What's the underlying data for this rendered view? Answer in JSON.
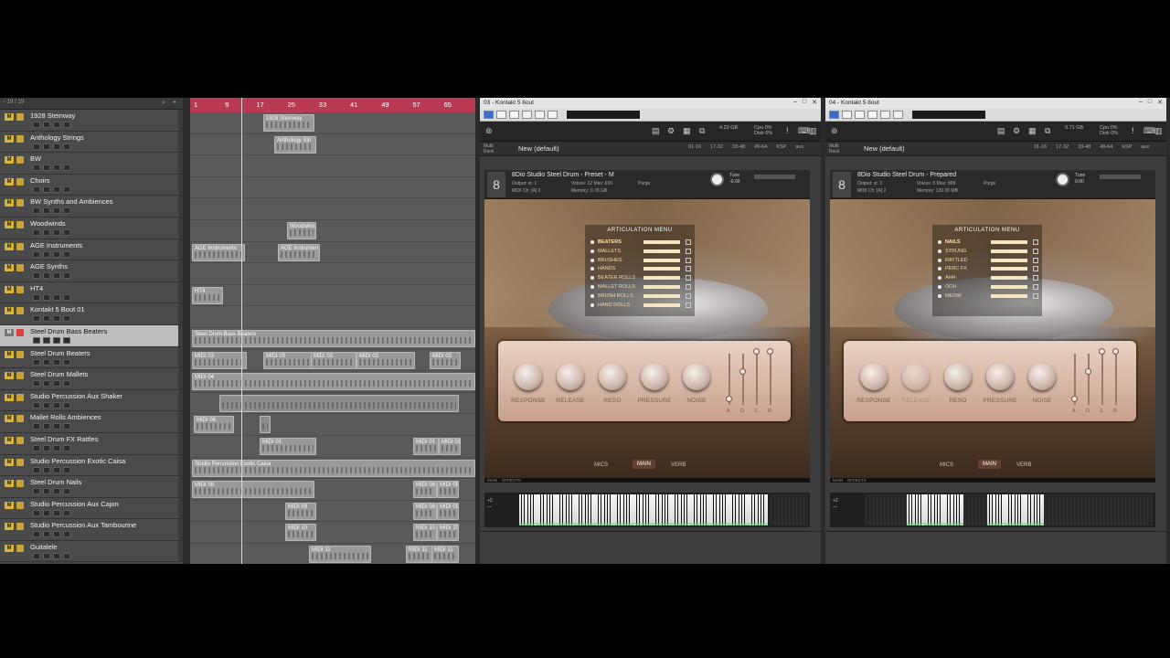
{
  "tracklist": {
    "header_text": "↑ 19 / 19",
    "tracks": [
      {
        "name": "1928 Steinway",
        "selected": false
      },
      {
        "name": "Anthology Strings",
        "selected": false
      },
      {
        "name": "BW",
        "selected": false
      },
      {
        "name": "Choirs",
        "selected": false
      },
      {
        "name": "BW Synths and Ambiences",
        "selected": false
      },
      {
        "name": "Woodwinds",
        "selected": false
      },
      {
        "name": "AGE Instruments",
        "selected": false
      },
      {
        "name": "AGE Synths",
        "selected": false
      },
      {
        "name": "HT4",
        "selected": false
      },
      {
        "name": "Kontakt 5 Bout 01",
        "selected": false
      },
      {
        "name": "Steel Drum Bass Beaters",
        "selected": true
      },
      {
        "name": "Steel Drum Beaters",
        "selected": false
      },
      {
        "name": "Steel Drum Mallets",
        "selected": false
      },
      {
        "name": "Studio Percussion Aux Shaker",
        "selected": false
      },
      {
        "name": "Mallet Rolls Ambiences",
        "selected": false
      },
      {
        "name": "Steel Drum FX Rattles",
        "selected": false
      },
      {
        "name": "Studio Percussion Exotic Caisa",
        "selected": false
      },
      {
        "name": "Steel Drum Nails",
        "selected": false
      },
      {
        "name": "Studio Percussion Aux Cajon",
        "selected": false
      },
      {
        "name": "Studio Percussion Aux Tambourine",
        "selected": false
      },
      {
        "name": "Guitalele",
        "selected": false
      }
    ]
  },
  "ruler": {
    "ticks": [
      "1",
      "9",
      "17",
      "25",
      "33",
      "41",
      "49",
      "57",
      "65"
    ]
  },
  "regions": [
    {
      "lane": 0,
      "label": "1928 Steinway",
      "start": 80,
      "width": 56
    },
    {
      "lane": 1,
      "label": "Anthology Stri",
      "start": 92,
      "width": 46
    },
    {
      "lane": 5,
      "label": "Woodwins",
      "start": 106,
      "width": 32
    },
    {
      "lane": 6,
      "label": "AGE Instruments",
      "start": 2,
      "width": 58
    },
    {
      "lane": 6,
      "label": "AGE Instrumen",
      "start": 96,
      "width": 46
    },
    {
      "lane": 8,
      "label": "HT4",
      "start": 2,
      "width": 34
    },
    {
      "lane": 10,
      "label": "Steel Drum Bass Beaters",
      "start": 2,
      "width": 310
    },
    {
      "lane": 11,
      "label": "MIDI 03",
      "start": 2,
      "width": 60
    },
    {
      "lane": 11,
      "label": "MIDI 03",
      "start": 80,
      "width": 56
    },
    {
      "lane": 11,
      "label": "MIDI 03",
      "start": 132,
      "width": 50
    },
    {
      "lane": 11,
      "label": "MIDI 03",
      "start": 182,
      "width": 64
    },
    {
      "lane": 11,
      "label": "MIDI 03",
      "start": 262,
      "width": 34
    },
    {
      "lane": 12,
      "label": "MIDI 04",
      "start": 2,
      "width": 310
    },
    {
      "lane": 13,
      "label": "",
      "start": 32,
      "width": 262
    },
    {
      "lane": 14,
      "label": "MIDI 06",
      "start": 4,
      "width": 44
    },
    {
      "lane": 14,
      "label": "",
      "start": 76,
      "width": 12
    },
    {
      "lane": 15,
      "label": "MIDI 01",
      "start": 76,
      "width": 62
    },
    {
      "lane": 15,
      "label": "MIDI 01",
      "start": 244,
      "width": 28
    },
    {
      "lane": 15,
      "label": "MIDI 01",
      "start": 272,
      "width": 24
    },
    {
      "lane": 16,
      "label": "Studio Percussion Exotic Caisa",
      "start": 2,
      "width": 310
    },
    {
      "lane": 17,
      "label": "MIDI 08",
      "start": 2,
      "width": 134
    },
    {
      "lane": 17,
      "label": "MIDI 08",
      "start": 244,
      "width": 26
    },
    {
      "lane": 17,
      "label": "MIDI 08",
      "start": 270,
      "width": 24
    },
    {
      "lane": 18,
      "label": "MIDI 09",
      "start": 104,
      "width": 34
    },
    {
      "lane": 18,
      "label": "MIDI 09",
      "start": 244,
      "width": 26
    },
    {
      "lane": 18,
      "label": "MIDI 09",
      "start": 270,
      "width": 24
    },
    {
      "lane": 19,
      "label": "MIDI 10",
      "start": 104,
      "width": 34
    },
    {
      "lane": 19,
      "label": "MIDI 10",
      "start": 244,
      "width": 26
    },
    {
      "lane": 19,
      "label": "MIDI 10",
      "start": 270,
      "width": 24
    },
    {
      "lane": 20,
      "label": "MIDI 11",
      "start": 130,
      "width": 68
    },
    {
      "lane": 20,
      "label": "MIDI 11",
      "start": 236,
      "width": 30
    },
    {
      "lane": 20,
      "label": "MIDI 11",
      "start": 264,
      "width": 30
    }
  ],
  "kontakt_left": {
    "title": "03 - Kontakt 5 8out",
    "toolbar": {
      "cpu_label": "Cpu 0%\nDisk 0%",
      "mem": "4.23 GB",
      "voices": "0"
    },
    "multi_rack": "Multi\nRack",
    "preset": "New (default)",
    "rack_tabs": [
      "01-16",
      "17-32",
      "33-48",
      "49-64",
      "KSP",
      "aux"
    ],
    "instrument": {
      "name": "8Dio Studio Steel Drum - Preset - M",
      "output": "Output: st. 1",
      "midi": "MIDI Ch: [A] 2",
      "voices": "Voices: 12 Max: 699",
      "memory": "Memory: 0.70 GB",
      "purge": "Purge",
      "tune_label": "Tune",
      "tune_value": "-0.00"
    },
    "articulation": {
      "title": "ARTICULATION MENU",
      "items": [
        {
          "label": "BEATERS",
          "on": true
        },
        {
          "label": "MALLETS",
          "on": false
        },
        {
          "label": "BRUSHES",
          "on": false
        },
        {
          "label": "HANDS",
          "on": false
        },
        {
          "label": "BEATER ROLLS",
          "on": false
        },
        {
          "label": "MALLET ROLLS",
          "on": false
        },
        {
          "label": "BRUSH ROLLS",
          "on": false
        },
        {
          "label": "HAND ROLLS",
          "on": false
        }
      ]
    },
    "knobs": [
      {
        "label": "RESPONSE",
        "dim": false
      },
      {
        "label": "RELEASE",
        "dim": false
      },
      {
        "label": "RESO",
        "dim": false
      },
      {
        "label": "PRESSURE",
        "dim": false
      },
      {
        "label": "NOISE",
        "dim": false
      }
    ],
    "adsr": [
      "A",
      "D",
      "S",
      "R"
    ],
    "bottom_tabs": [
      {
        "label": "MICS",
        "on": false
      },
      {
        "label": "MAIN",
        "on": true
      },
      {
        "label": "VERB",
        "on": false
      }
    ],
    "footer": "MAIN    EFFECTS"
  },
  "kontakt_right": {
    "title": "04 - Kontakt 5 8out",
    "toolbar": {
      "cpu_label": "Cpu 0%\nDisk 0%",
      "mem": "0.71 GB",
      "voices": "0"
    },
    "multi_rack": "Multi\nRack",
    "preset": "New (default)",
    "rack_tabs": [
      "01-16",
      "17-32",
      "33-48",
      "49-64",
      "KSP",
      "aux"
    ],
    "instrument": {
      "name": "8Dio Studio Steel Drum - Prepared",
      "output": "Output: st. 1",
      "midi": "MIDI Ch: [A] 2",
      "voices": "Voices: 0 Max: 999",
      "memory": "Memory: 120.00 MB",
      "purge": "Purge",
      "tune_label": "Tune",
      "tune_value": "0.00"
    },
    "articulation": {
      "title": "ARTICULATION MENU",
      "items": [
        {
          "label": "NAILS",
          "on": true
        },
        {
          "label": "STRUNG",
          "on": false
        },
        {
          "label": "RATTLED",
          "on": false
        },
        {
          "label": "PERC FX",
          "on": false
        },
        {
          "label": "AHH",
          "on": false
        },
        {
          "label": "OOH",
          "on": false
        },
        {
          "label": "MEOW",
          "on": false
        }
      ]
    },
    "knobs": [
      {
        "label": "RESPONSE",
        "dim": false
      },
      {
        "label": "RELEASE",
        "dim": true
      },
      {
        "label": "RESO",
        "dim": false
      },
      {
        "label": "PRESSURE",
        "dim": false
      },
      {
        "label": "NOISE",
        "dim": false
      }
    ],
    "adsr": [
      "A",
      "D",
      "S",
      "R"
    ],
    "bottom_tabs": [
      {
        "label": "MICS",
        "on": false
      },
      {
        "label": "MAIN",
        "on": true
      },
      {
        "label": "VERB",
        "on": false
      }
    ],
    "footer": "MAIN    EFFECTS"
  },
  "keyboard": {
    "side_label": "+2\n—"
  },
  "colors": {
    "ruler": "#b93a52",
    "accent_green": "#67d07b",
    "record": "#d94040",
    "mute_yellow": "#d9b63a"
  }
}
